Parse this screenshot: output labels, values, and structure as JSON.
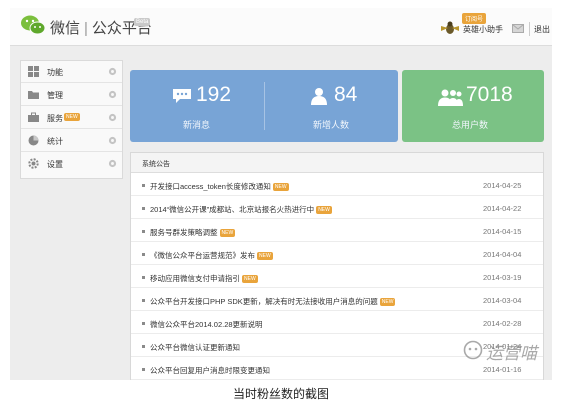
{
  "header": {
    "brand_name": "微信",
    "separator": "|",
    "product_name": "公众平台",
    "beta_label": "Beta",
    "subscription_badge": "订阅号",
    "username": "英雄小助手",
    "logout_label": "退出"
  },
  "sidebar": {
    "items": [
      {
        "label": "功能",
        "icon": "grid-icon"
      },
      {
        "label": "管理",
        "icon": "folder-icon"
      },
      {
        "label": "服务",
        "icon": "briefcase-icon",
        "badge": "NEW"
      },
      {
        "label": "统计",
        "icon": "pie-chart-icon"
      },
      {
        "label": "设置",
        "icon": "gear-icon"
      }
    ]
  },
  "stats": {
    "messages": {
      "value": "192",
      "label": "新消息"
    },
    "new_followers": {
      "value": "84",
      "label": "新增人数"
    },
    "total_users": {
      "value": "7018",
      "label": "总用户数"
    }
  },
  "announcements": {
    "title": "系统公告",
    "new_badge": "NEW",
    "items": [
      {
        "title": "开发接口access_token长度修改通知",
        "date": "2014-04-25",
        "is_new": true
      },
      {
        "title": "2014“微信公开课”成都站、北京站报名火热进行中",
        "date": "2014-04-22",
        "is_new": true
      },
      {
        "title": "服务号群发策略调整",
        "date": "2014-04-15",
        "is_new": true
      },
      {
        "title": "《微信公众平台运营规范》发布",
        "date": "2014-04-04",
        "is_new": true
      },
      {
        "title": "移动应用微信支付申请指引",
        "date": "2014-03-19",
        "is_new": true
      },
      {
        "title": "公众平台开发接口PHP SDK更新，解决有时无法接收用户消息的问题",
        "date": "2014-03-04",
        "is_new": true
      },
      {
        "title": "微信公众平台2014.02.28更新说明",
        "date": "2014-02-28",
        "is_new": false
      },
      {
        "title": "公众平台微信认证更新通知",
        "date": "2014-01-24",
        "is_new": false
      },
      {
        "title": "公众平台回复用户消息时限变更通知",
        "date": "2014-01-16",
        "is_new": false
      }
    ]
  },
  "watermark": "运营喵",
  "caption": "当时粉丝数的截图",
  "colors": {
    "stat_blue": "#78a4d6",
    "stat_green": "#7bc285",
    "new_badge": "#e9a43b"
  }
}
